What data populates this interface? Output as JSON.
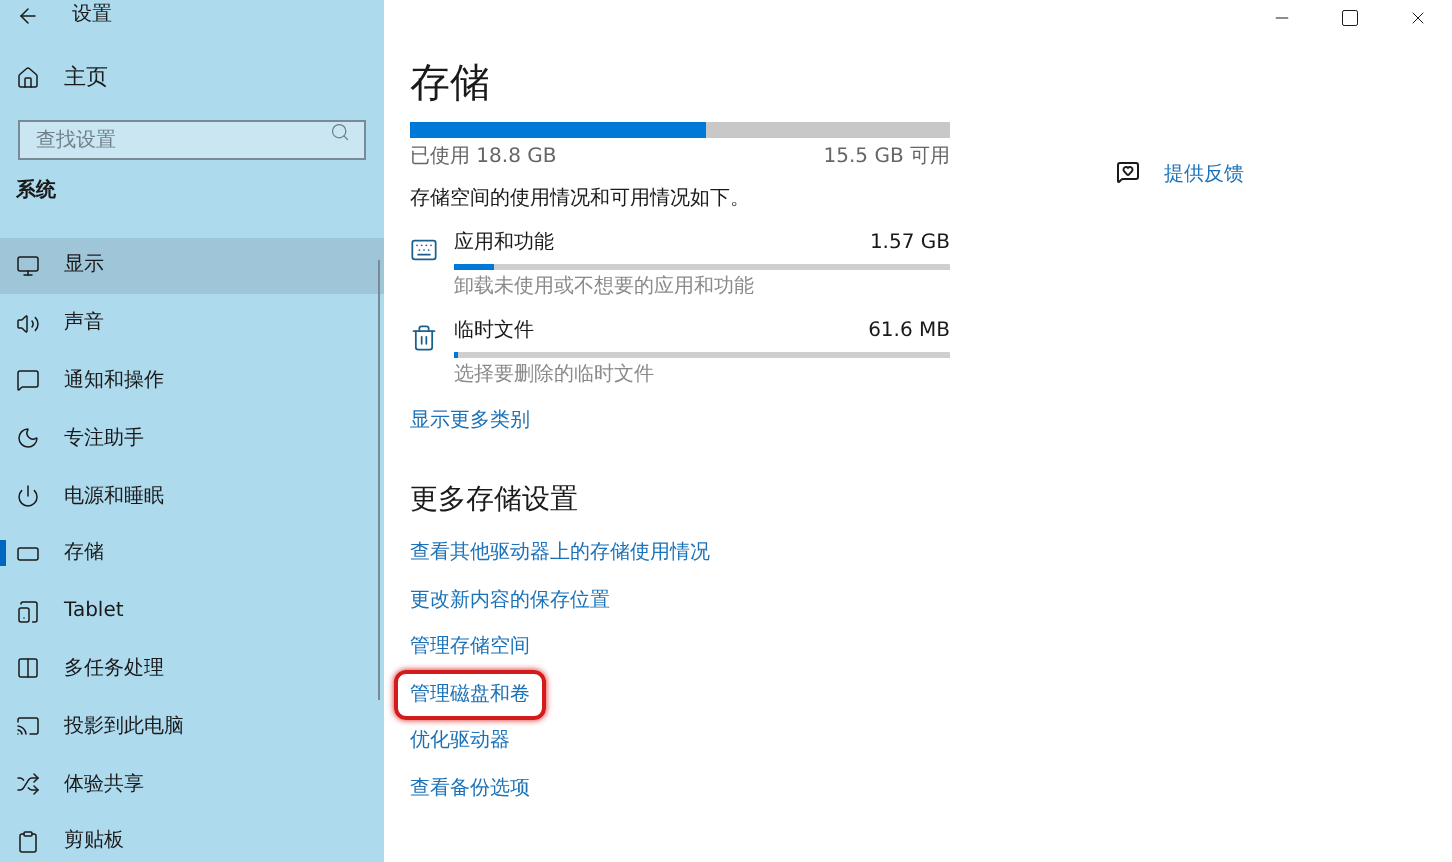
{
  "window": {
    "title": "设置"
  },
  "sidebar": {
    "home": "主页",
    "search": {
      "placeholder": "查找设置"
    },
    "section": "系统",
    "items": [
      {
        "label": "显示",
        "selected": false,
        "hovered": true
      },
      {
        "label": "声音",
        "selected": false,
        "hovered": false
      },
      {
        "label": "通知和操作",
        "selected": false,
        "hovered": false
      },
      {
        "label": "专注助手",
        "selected": false,
        "hovered": false
      },
      {
        "label": "电源和睡眠",
        "selected": false,
        "hovered": false
      },
      {
        "label": "存储",
        "selected": true,
        "hovered": false
      },
      {
        "label": "Tablet",
        "selected": false,
        "hovered": false
      },
      {
        "label": "多任务处理",
        "selected": false,
        "hovered": false
      },
      {
        "label": "投影到此电脑",
        "selected": false,
        "hovered": false
      },
      {
        "label": "体验共享",
        "selected": false,
        "hovered": false
      },
      {
        "label": "剪贴板",
        "selected": false,
        "hovered": false
      }
    ]
  },
  "main": {
    "title": "存储",
    "usage": {
      "level": 0.548,
      "used": "已使用 18.8 GB",
      "free": "15.5 GB 可用"
    },
    "description": "存储空间的使用情况和可用情况如下。",
    "categories": [
      {
        "name": "应用和功能",
        "size": "1.57 GB",
        "level": 0.08,
        "hint": "卸载未使用或不想要的应用和功能"
      },
      {
        "name": "临时文件",
        "size": "61.6 MB",
        "level": 0.01,
        "hint": "选择要删除的临时文件"
      }
    ],
    "show_more": "显示更多类别",
    "more_title": "更多存储设置",
    "links": [
      {
        "label": "查看其他驱动器上的存储使用情况",
        "highlighted": false
      },
      {
        "label": "更改新内容的保存位置",
        "highlighted": false
      },
      {
        "label": "管理存储空间",
        "highlighted": false
      },
      {
        "label": "管理磁盘和卷",
        "highlighted": true
      },
      {
        "label": "优化驱动器",
        "highlighted": false
      },
      {
        "label": "查看备份选项",
        "highlighted": false
      }
    ]
  },
  "feedback": "提供反馈"
}
